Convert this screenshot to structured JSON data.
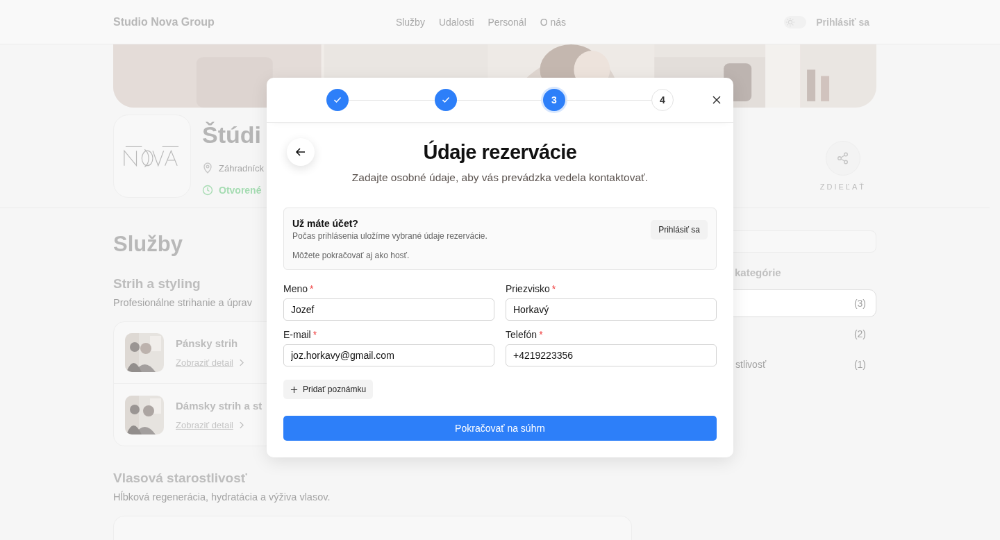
{
  "header": {
    "brand": "Studio Nova Group",
    "nav": [
      {
        "label": "Služby"
      },
      {
        "label": "Udalosti"
      },
      {
        "label": "Personál"
      },
      {
        "label": "O nás"
      }
    ],
    "theme_toggle": {
      "on": false
    },
    "login": "Prihlásiť sa"
  },
  "business": {
    "name": "Štúdi",
    "address": "Záhradníck",
    "status": "Otvorené",
    "share": "ZDIEĽAŤ"
  },
  "services": {
    "title": "Služby",
    "categories": [
      {
        "title": "Strih a styling",
        "description": "Profesionálne strihanie a úprav",
        "items": [
          {
            "name": "Pánsky strih",
            "link": "Zobraziť detail"
          },
          {
            "name": "Dámsky strih a st",
            "link": "Zobraziť detail"
          }
        ]
      },
      {
        "title": "Vlasová starostlivosť",
        "description": "Hĺbková regenerácia, hydratácia a výživa vlasov.",
        "card": true
      }
    ]
  },
  "sidebar": {
    "categories_heading": "kategórie",
    "categories": [
      {
        "count": "(3)",
        "selected": true
      },
      {
        "count": "(2)",
        "selected": false
      },
      {
        "label": "stlivosť",
        "count": "(1)",
        "selected": false
      }
    ]
  },
  "modal": {
    "steps": [
      {
        "completed": true,
        "selected": false
      },
      {
        "completed": true,
        "selected": false
      },
      {
        "completed": false,
        "selected": true,
        "label": "3"
      },
      {
        "completed": false,
        "selected": false,
        "label": "4"
      }
    ],
    "title": "Údaje rezervácie",
    "subtitle": "Zadajte osobné údaje, aby vás prevádzka vedela kontaktovať.",
    "account": {
      "title": "Už máte účet?",
      "text": "Počas prihlásenia uložíme vybrané údaje rezervácie.",
      "note": "Môžete pokračovať aj ako hosť.",
      "button": "Prihlásiť sa"
    },
    "fields": [
      {
        "label": "Meno",
        "required_mark": "*",
        "value": "Jozef"
      },
      {
        "label": "Priezvisko",
        "required_mark": "*",
        "value": "Horkavý"
      },
      {
        "label": "E-mail",
        "required_mark": "*",
        "value": "joz.horkavy@gmail.com"
      },
      {
        "label": "Telefón",
        "required_mark": "*",
        "value": "+4219223356"
      }
    ],
    "add_note": "Pridať poznámku",
    "submit": "Pokračovať na súhrn"
  }
}
